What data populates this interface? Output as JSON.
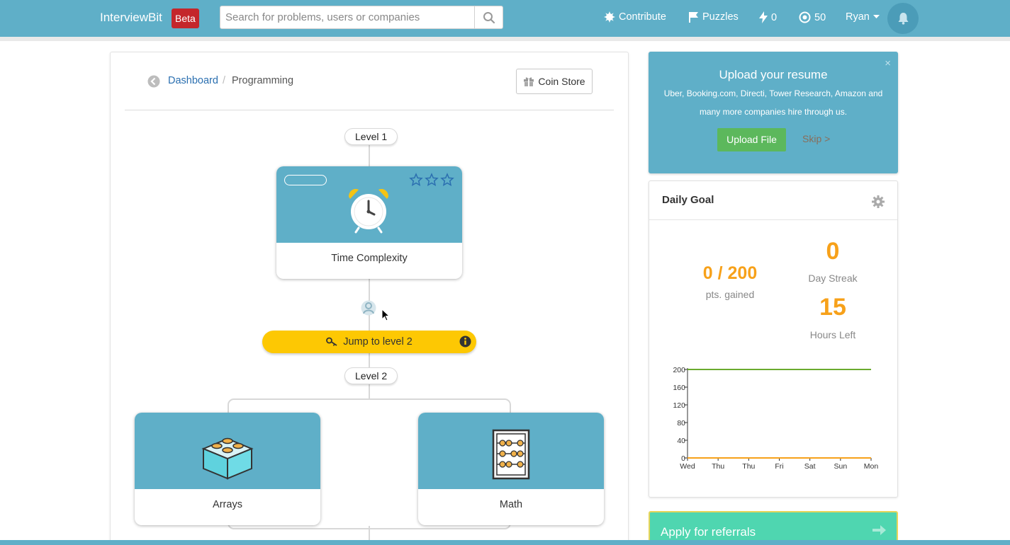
{
  "navbar": {
    "brand": "InterviewBit",
    "badge": "Beta",
    "search_placeholder": "Search for problems, users or companies",
    "contribute": "Contribute",
    "puzzles": "Puzzles",
    "streak_count": "0",
    "coins_count": "50",
    "user": "Ryan"
  },
  "breadcrumb": {
    "parent": "Dashboard",
    "separator": "/",
    "current": "Programming"
  },
  "coin_store": "Coin Store",
  "levels": {
    "level1": "Level 1",
    "level2": "Level 2"
  },
  "cards": {
    "time_complexity": {
      "label": "Time Complexity",
      "icon": "alarm-clock-icon",
      "stars": 3
    },
    "arrays": {
      "label": "Arrays",
      "icon": "lego-brick-icon"
    },
    "math": {
      "label": "Math",
      "icon": "abacus-icon"
    }
  },
  "jump_button": "Jump to level 2",
  "resume": {
    "title": "Upload your resume",
    "subtitle": "Uber, Booking.com, Directi, Tower Research, Amazon and many more companies hire through us.",
    "close": "×",
    "upload": "Upload File",
    "skip": "Skip >"
  },
  "daily_goal": {
    "title": "Daily Goal",
    "points": "0 / 200",
    "points_label": "pts. gained",
    "streak": "0",
    "streak_label": "Day Streak",
    "hours": "15",
    "hours_label": "Hours Left"
  },
  "chart_data": {
    "type": "line",
    "categories": [
      "Wed",
      "Thu",
      "Thu",
      "Fri",
      "Sat",
      "Sun",
      "Mon"
    ],
    "series": [
      {
        "values": [
          200,
          200,
          200,
          200,
          200,
          200,
          200
        ],
        "color": "#6aab2e"
      },
      {
        "values": [
          0,
          0,
          0,
          0,
          0,
          0,
          0
        ],
        "color": "#f7a11a"
      }
    ],
    "yticks": [
      0,
      40,
      80,
      120,
      160,
      200
    ],
    "ylim": [
      0,
      200
    ]
  },
  "referral": "Apply for referrals",
  "colors": {
    "primary": "#5fafc8",
    "accent_orange": "#f7a11a",
    "jump_yellow": "#fdc803",
    "success_green": "#5cb85c",
    "beta_red": "#c4262b"
  }
}
